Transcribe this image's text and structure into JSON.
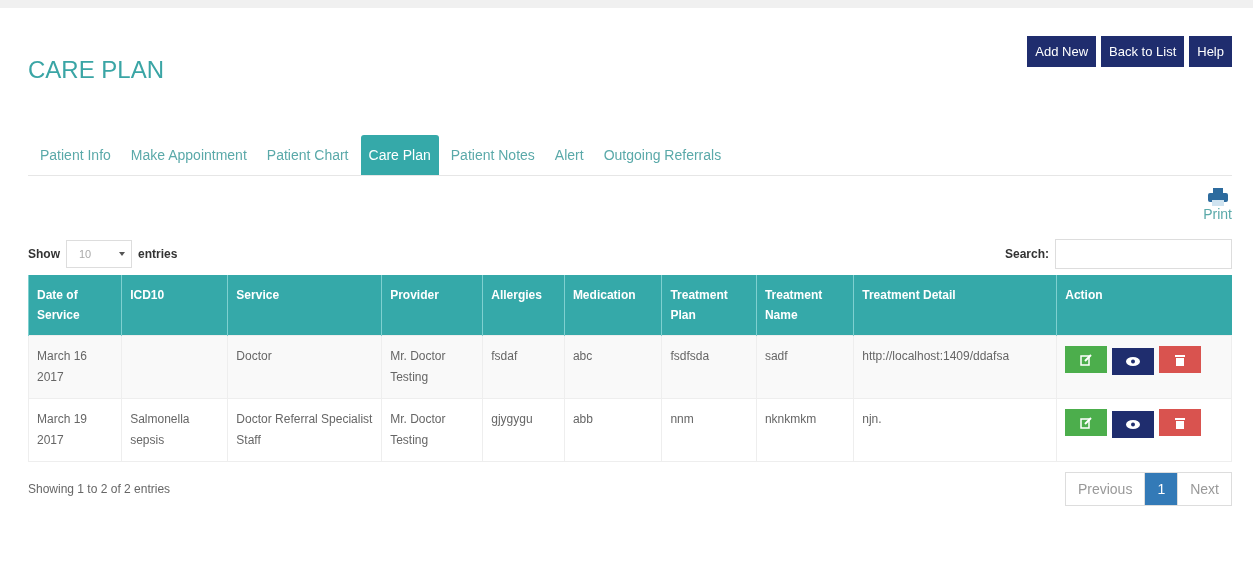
{
  "page_title": "CARE PLAN",
  "header_buttons": [
    "Add New",
    "Back to List",
    "Help"
  ],
  "tabs": [
    {
      "label": "Patient Info",
      "selected": false
    },
    {
      "label": "Make Appointment",
      "selected": false
    },
    {
      "label": "Patient Chart",
      "selected": false
    },
    {
      "label": "Care Plan",
      "selected": true
    },
    {
      "label": "Patient Notes",
      "selected": false
    },
    {
      "label": "Alert",
      "selected": false
    },
    {
      "label": "Outgoing Referrals",
      "selected": false
    }
  ],
  "print_label": "Print",
  "length_control": {
    "before": "Show",
    "value": "10",
    "after": "entries"
  },
  "search": {
    "label": "Search:"
  },
  "table": {
    "columns": [
      "Date of Service",
      "ICD10",
      "Service",
      "Provider",
      "Allergies",
      "Medication",
      "Treatment Plan",
      "Treatment Name",
      "Treatment Detail",
      "Action"
    ],
    "rows": [
      {
        "cells": [
          "March 16 2017",
          "",
          "Doctor",
          "Mr. Doctor Testing",
          "fsdaf",
          "abc",
          "fsdfsda",
          "sadf",
          "http://localhost:1409/ddafsa"
        ]
      },
      {
        "cells": [
          "March 19 2017",
          "Salmonella sepsis",
          "Doctor Referral Specialist Staff",
          "Mr. Doctor Testing",
          "gjygygu",
          "abb",
          "nnm",
          "nknkmkm",
          "njn."
        ]
      }
    ]
  },
  "info": "Showing 1 to 2 of 2 entries",
  "pagination": [
    {
      "label": "Previous",
      "selected": false
    },
    {
      "label": "1",
      "selected": true
    },
    {
      "label": "Next",
      "selected": false
    }
  ]
}
